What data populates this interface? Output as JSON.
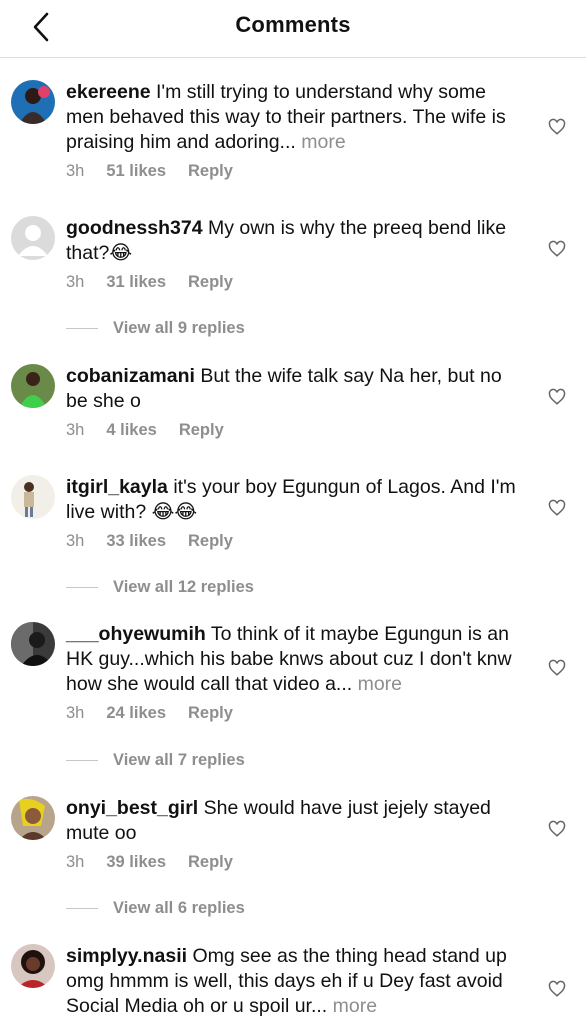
{
  "header": {
    "title": "Comments"
  },
  "comments": [
    {
      "username": "ekereene",
      "text": "I'm still trying to understand why some men behaved this way to their partners. The wife is praising him and adoring...",
      "more": "more",
      "time": "3h",
      "likes": "51 likes",
      "reply": "Reply"
    },
    {
      "username": "goodnessh374",
      "text": "My own is why the preeq bend like that?😂",
      "more": "",
      "time": "3h",
      "likes": "31 likes",
      "reply": "Reply",
      "view_replies": "View all 9 replies"
    },
    {
      "username": "cobanizamani",
      "text": "But the wife talk say Na her, but no be she o",
      "more": "",
      "time": "3h",
      "likes": "4 likes",
      "reply": "Reply"
    },
    {
      "username": "itgirl_kayla",
      "text": "it's your boy Egungun of Lagos. And I'm live with? 😂😂",
      "more": "",
      "time": "3h",
      "likes": "33 likes",
      "reply": "Reply",
      "view_replies": "View all 12 replies"
    },
    {
      "username": "___ohyewumih",
      "text": "To think of it maybe Egungun is an HK guy...which his babe knws about cuz I don't knw how she would call that video a...",
      "more": "more",
      "time": "3h",
      "likes": "24 likes",
      "reply": "Reply",
      "view_replies": "View all 7 replies"
    },
    {
      "username": "onyi_best_girl",
      "text": "She would have just jejely stayed mute oo",
      "more": "",
      "time": "3h",
      "likes": "39 likes",
      "reply": "Reply",
      "view_replies": "View all 6 replies"
    },
    {
      "username": "simplyy.nasii",
      "text": "Omg see as the thing head stand up omg hmmm is well, this days eh if u Dey fast avoid Social Media oh or u spoil ur...",
      "more": "more",
      "time": "",
      "likes": "",
      "reply": ""
    }
  ],
  "icons": {
    "back": "chevron-left-icon",
    "heart": "heart-outline-icon"
  }
}
